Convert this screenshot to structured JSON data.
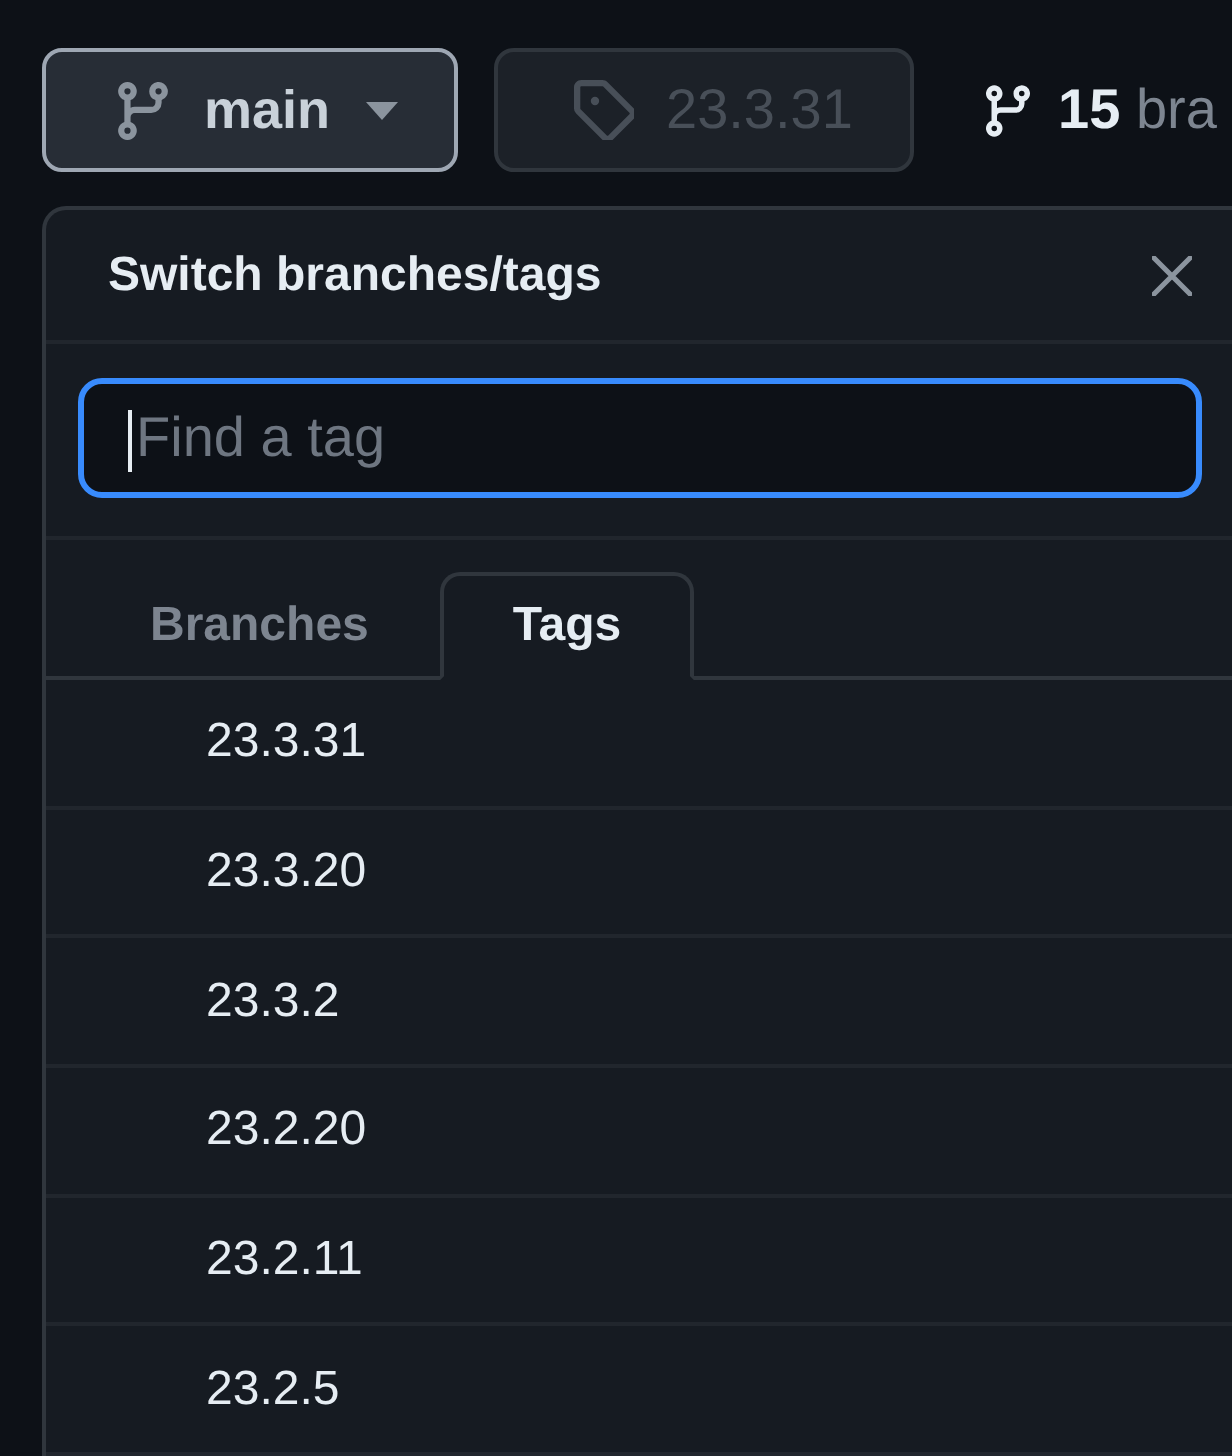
{
  "branch_button": {
    "label": "main",
    "expanded": true
  },
  "tag_button": {
    "label": "23.3.31",
    "disabled": true
  },
  "branches_link": {
    "count": "15",
    "label": "bra"
  },
  "dropdown": {
    "title": "Switch branches/tags",
    "search": {
      "placeholder": "Find a tag",
      "focused": true
    },
    "tabs": [
      {
        "label": "Branches",
        "selected": false
      },
      {
        "label": "Tags",
        "selected": true
      }
    ],
    "items": [
      {
        "label": "23.3.31"
      },
      {
        "label": "23.3.20"
      },
      {
        "label": "23.3.2"
      },
      {
        "label": "23.2.20"
      },
      {
        "label": "23.2.11"
      },
      {
        "label": "23.2.5"
      }
    ]
  }
}
